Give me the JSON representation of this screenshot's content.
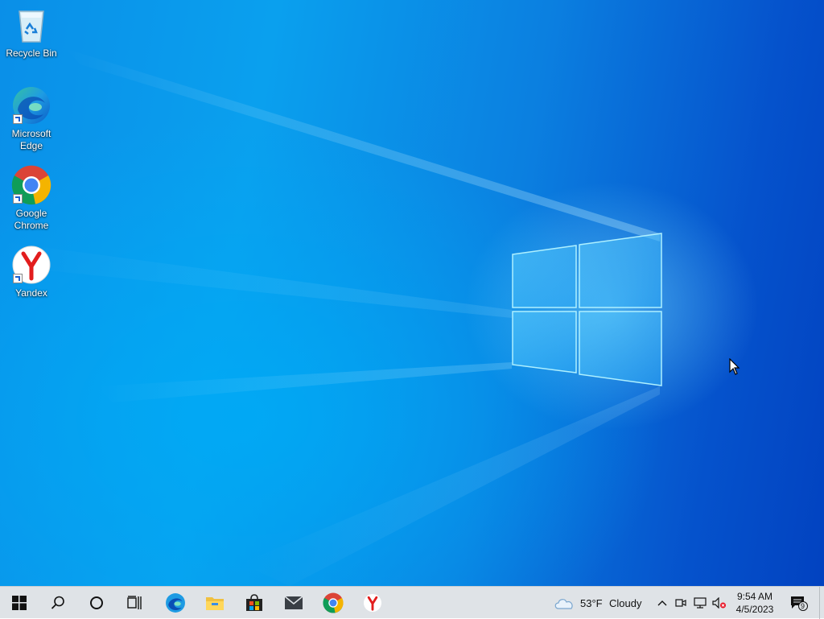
{
  "desktop": {
    "icons": [
      {
        "label": "Recycle Bin",
        "icon": "recycle-bin-icon"
      },
      {
        "label": "Microsoft\nEdge",
        "icon": "edge-icon"
      },
      {
        "label": "Google\nChrome",
        "icon": "chrome-icon"
      },
      {
        "label": "Yandex",
        "icon": "yandex-icon"
      }
    ],
    "wallpaper": "windows-10-hero"
  },
  "taskbar": {
    "pinned": [
      "start-icon",
      "search-icon",
      "cortana-icon",
      "task-view-icon",
      "edge-icon",
      "file-explorer-icon",
      "microsoft-store-icon",
      "mail-icon",
      "chrome-icon",
      "yandex-icon"
    ],
    "weather": {
      "temp": "53°F",
      "condition": "Cloudy"
    },
    "clock": {
      "time": "9:54 AM",
      "date": "4/5/2023"
    },
    "notifications_count": "9"
  },
  "colors": {
    "taskbar_bg": "#dfe3e7",
    "wallpaper_blue": "#0a8fe8"
  }
}
